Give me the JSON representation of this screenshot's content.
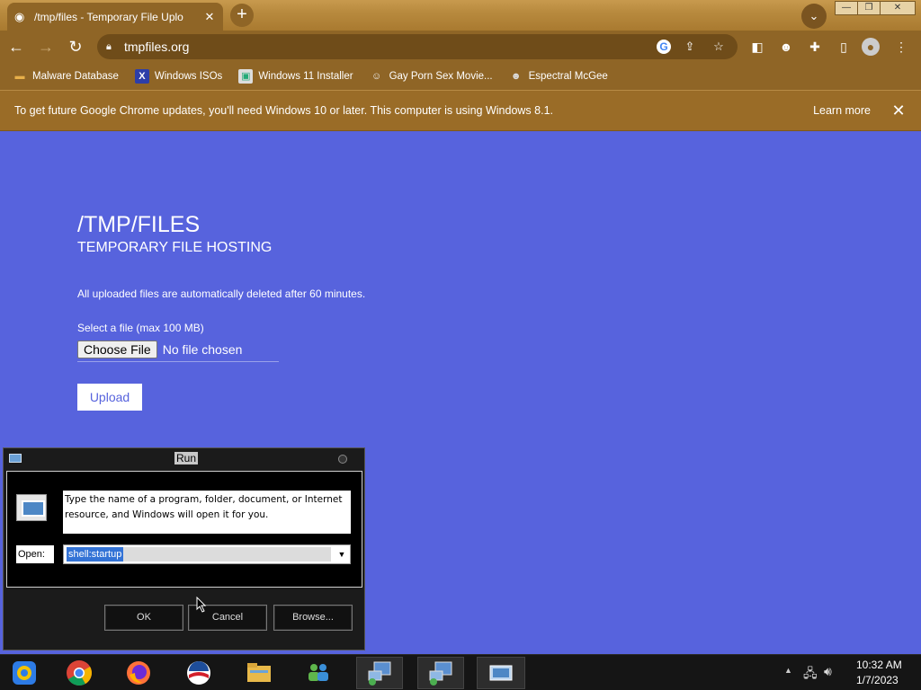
{
  "browser": {
    "tab": {
      "title": "/tmp/files - Temporary File Uplo",
      "favicon": "globe-icon",
      "close": "✕"
    },
    "new_tab": "+",
    "window_controls": {
      "minimize": "—",
      "restore": "❐",
      "close": "✕"
    },
    "url": "tmpfiles.org",
    "bookmarks": [
      {
        "label": "Malware Database",
        "icon": "folder-icon"
      },
      {
        "label": "Windows ISOs",
        "icon": "x-icon"
      },
      {
        "label": "Windows 11 Installer",
        "icon": "image-icon"
      },
      {
        "label": "Gay Porn Sex Movie...",
        "icon": "face-icon"
      },
      {
        "label": "Espectral McGee",
        "icon": "avatar-icon"
      }
    ],
    "infobar": {
      "message": "To get future Google Chrome updates, you'll need Windows 10 or later. This computer is using Windows 8.1.",
      "action": "Learn more"
    },
    "theme_color": "#8f6526"
  },
  "page": {
    "title": "/TMP/FILES",
    "subtitle": "TEMPORARY FILE HOSTING",
    "notice": "All uploaded files are automatically deleted after 60 minutes.",
    "select_label": "Select a file (max 100 MB)",
    "choose_file": "Choose File",
    "no_file": "No file chosen",
    "upload": "Upload",
    "background": "#5763dd"
  },
  "run_dialog": {
    "title": "Run",
    "description": "Type the name of a program, folder, document, or Internet resource, and Windows will open it for you.",
    "open_label": "Open:",
    "input_value": "shell:startup",
    "buttons": {
      "ok": "OK",
      "cancel": "Cancel",
      "browse": "Browse..."
    }
  },
  "taskbar": {
    "apps": [
      "chrome-legacy-icon",
      "chrome-icon",
      "firefox-icon",
      "obama-logo-icon",
      "file-explorer-icon",
      "network-people-icon",
      "remote-desktop-icon",
      "remote-desktop-icon",
      "run-window-icon"
    ],
    "clock": {
      "time": "10:32 AM",
      "date": "1/7/2023"
    }
  }
}
